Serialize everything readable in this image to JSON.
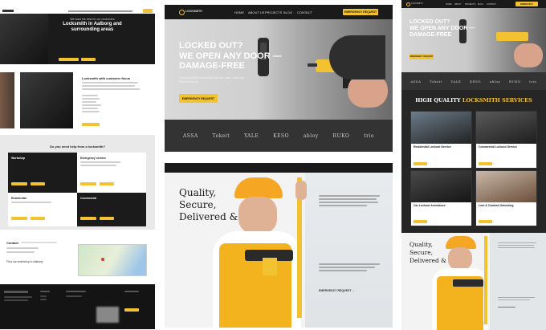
{
  "col_a": {
    "hero": {
      "title_line1": "Locksmith in Aalborg and",
      "title_line2": "surrounding areas",
      "small_heading": "We want the best for our customers",
      "btn1": "",
      "btn2": ""
    },
    "about": {
      "heading": "Locksmith with customer focus",
      "btn": ""
    },
    "help": {
      "heading": "Do you need help from a locksmith?",
      "cards": [
        {
          "title": "Workshop"
        },
        {
          "title": "Emergency service"
        },
        {
          "title": "Residential"
        },
        {
          "title": "Commercial"
        }
      ]
    },
    "contact": {
      "heading": "Contact",
      "sub": "Find our workshop in Aalborg"
    }
  },
  "col_b": {
    "logo": "LOCKSMITH",
    "nav": [
      "HOME",
      "ABOUT US",
      "PROJECTS",
      "BLOG",
      "CONTACT"
    ],
    "nav_cta": "EMERGENCY REQUEST",
    "hero": {
      "headline_l1": "LOCKED OUT?",
      "headline_l2": "WE OPEN ANY DOOR —",
      "headline_l3": "DAMAGE-FREE",
      "sub_l1": "Fast certified locksmiths deliver safe, damage-",
      "sub_l2": "free solutions.",
      "cta": "EMERGENCY REQUEST"
    },
    "logos": [
      "ASSA",
      "Tokeit",
      "YALE",
      "KESO",
      "abloy",
      "RUKO",
      "trio"
    ],
    "worker": {
      "headline_l1": "Quality,",
      "headline_l2": "Secure,",
      "headline_l3": "Delivered &",
      "cta": "EMERGENCY REQUEST →"
    }
  },
  "col_c": {
    "logo": "LOCKSMITH",
    "nav": [
      "HOME",
      "ABOUT",
      "PROJECTS",
      "BLOG",
      "CONTACT"
    ],
    "nav_cta": "EMERGENCY",
    "hero": {
      "headline_l1": "LOCKED OUT?",
      "headline_l2": "WE OPEN ANY DOOR —",
      "headline_l3": "DAMAGE-FREE",
      "cta": "EMERGENCY REQUEST"
    },
    "logos": [
      "ASSA",
      "Tokeit",
      "YALE",
      "KESO",
      "abloy",
      "RUKO",
      "trio"
    ],
    "services_heading_l1": "HIGH QUALITY",
    "services_heading_l2": "LOCKSMITH SERVICES",
    "services": [
      {
        "title": "Residential Lockout Service"
      },
      {
        "title": "Commercial Lockout Service"
      },
      {
        "title": "Car Lockout Assistance"
      },
      {
        "title": "Lost & Cracked Unlocking"
      }
    ],
    "worker": {
      "headline_l1": "Quality,",
      "headline_l2": "Secure,",
      "headline_l3": "Delivered &"
    }
  },
  "colors": {
    "accent": "#f2c230",
    "dark": "#1b1b1b",
    "hardhat": "#f5a623"
  }
}
